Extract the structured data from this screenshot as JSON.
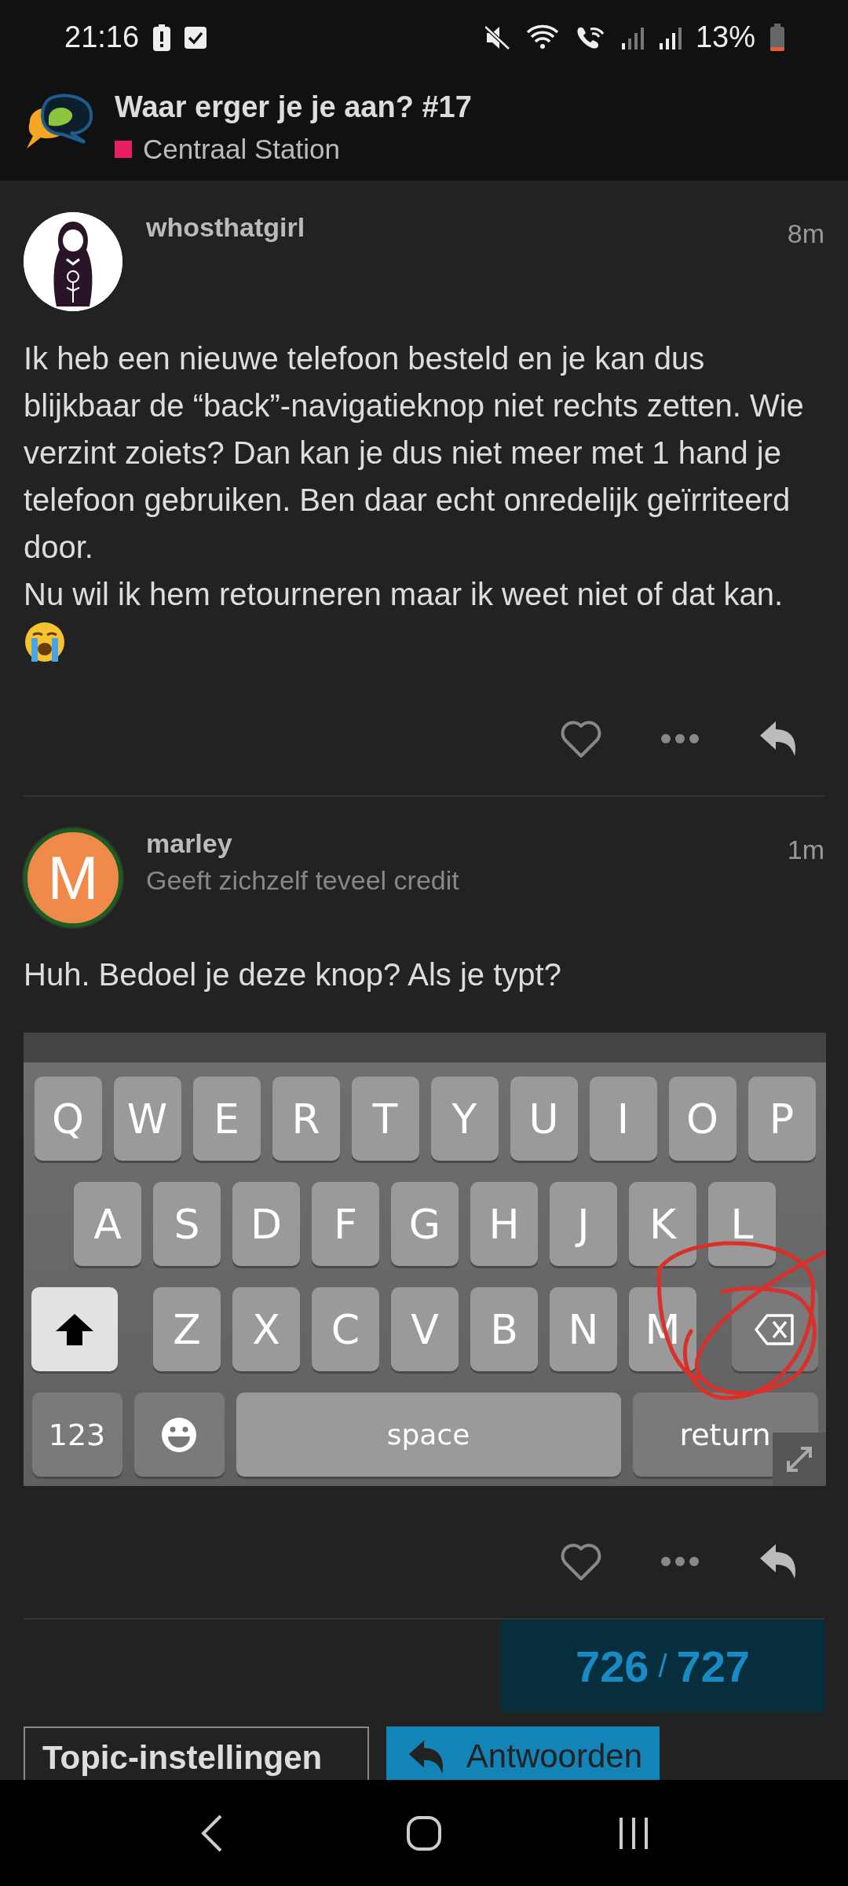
{
  "status_bar": {
    "time": "21:16",
    "battery": "13%"
  },
  "topic": {
    "title": "Waar erger je je aan? #17",
    "category": {
      "name": "Centraal Station",
      "color": "#e91e63"
    }
  },
  "posts": [
    {
      "kind": "image_avatar",
      "username": "whosthatgirl",
      "time": "8m",
      "paragraphs": [
        {
          "kind": "text",
          "text": "Ik heb een nieuwe telefoon besteld en je kan dus blijkbaar de “back”-navigatieknop niet rechts zetten. Wie verzint zoiets? Dan kan je dus niet meer met 1 hand je telefoon gebruiken. Ben daar echt onredelijk geïrriteerd door."
        },
        {
          "kind": "text",
          "text": "Nu wil ik hem retourneren maar ik weet niet of dat kan."
        },
        {
          "kind": "crying_emoji"
        }
      ]
    },
    {
      "kind": "letter_avatar",
      "avatar_letter": "M",
      "username": "marley",
      "subtitle": "Geeft zichzelf teveel credit",
      "time": "1m",
      "paragraphs": [
        {
          "kind": "text",
          "text": "Huh. Bedoel je deze knop? Als je typt?"
        }
      ],
      "keyboard": {
        "rows": [
          [
            {
              "kind": "char",
              "label": "Q"
            },
            {
              "kind": "char",
              "label": "W"
            },
            {
              "kind": "char",
              "label": "E"
            },
            {
              "kind": "char",
              "label": "R"
            },
            {
              "kind": "char",
              "label": "T"
            },
            {
              "kind": "char",
              "label": "Y"
            },
            {
              "kind": "char",
              "label": "U"
            },
            {
              "kind": "char",
              "label": "I"
            },
            {
              "kind": "char",
              "label": "O"
            },
            {
              "kind": "char",
              "label": "P"
            }
          ],
          [
            {
              "kind": "char",
              "label": "A"
            },
            {
              "kind": "char",
              "label": "S"
            },
            {
              "kind": "char",
              "label": "D"
            },
            {
              "kind": "char",
              "label": "F"
            },
            {
              "kind": "char",
              "label": "G"
            },
            {
              "kind": "char",
              "label": "H"
            },
            {
              "kind": "char",
              "label": "J"
            },
            {
              "kind": "char",
              "label": "K"
            },
            {
              "kind": "char",
              "label": "L"
            }
          ],
          [
            {
              "kind": "shift"
            },
            {
              "kind": "char",
              "label": "Z"
            },
            {
              "kind": "char",
              "label": "X"
            },
            {
              "kind": "char",
              "label": "C"
            },
            {
              "kind": "char",
              "label": "V"
            },
            {
              "kind": "char",
              "label": "B"
            },
            {
              "kind": "char",
              "label": "N"
            },
            {
              "kind": "char",
              "label": "M"
            },
            {
              "kind": "backspace"
            }
          ]
        ],
        "bottom_row": [
          {
            "kind": "wide",
            "label": "123"
          },
          {
            "kind": "emoji"
          },
          {
            "kind": "space",
            "label": "space"
          },
          {
            "kind": "return",
            "label": "return"
          }
        ]
      }
    }
  ],
  "progress": {
    "current": "726",
    "separator": "/",
    "total": "727"
  },
  "buttons": [
    {
      "kind": "outline",
      "label": "Topic-instellingen"
    },
    {
      "kind": "primary",
      "label": "Antwoorden"
    }
  ]
}
